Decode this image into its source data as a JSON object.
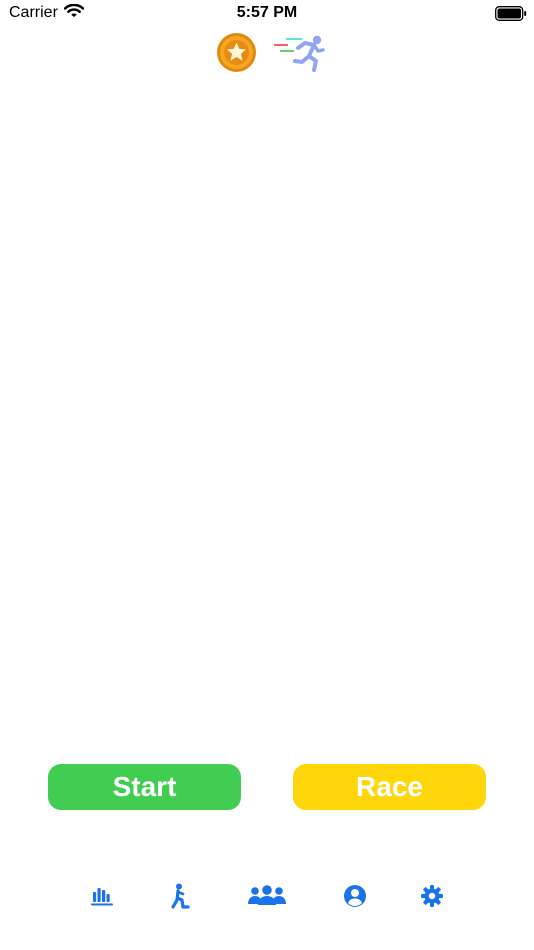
{
  "status_bar": {
    "carrier": "Carrier",
    "time": "5:57 PM"
  },
  "header": {
    "icons": [
      "coin-star-icon",
      "runner-icon"
    ]
  },
  "buttons": {
    "start_label": "Start",
    "race_label": "Race"
  },
  "tab_bar": {
    "items": [
      {
        "icon": "bar-chart-icon",
        "selected": true
      },
      {
        "icon": "walking-person-icon",
        "selected": false
      },
      {
        "icon": "group-icon",
        "selected": false
      },
      {
        "icon": "profile-icon",
        "selected": false
      },
      {
        "icon": "gear-icon",
        "selected": false
      }
    ]
  },
  "colors": {
    "start_green": "#41cd52",
    "race_yellow": "#ffd60a",
    "tab_blue": "#1a73e8"
  }
}
